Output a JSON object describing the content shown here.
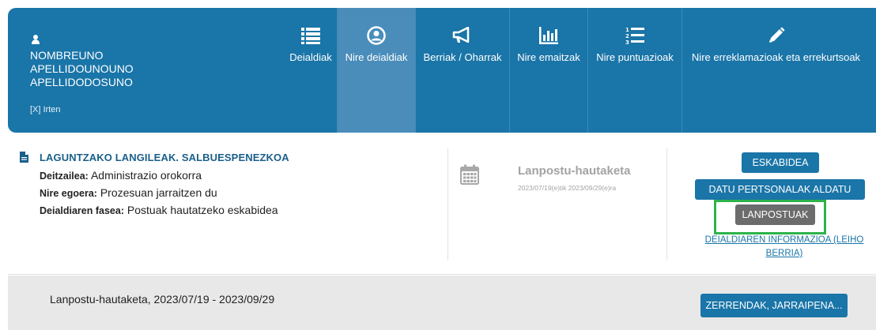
{
  "user": {
    "name_line1": "NOMBREUNO",
    "name_line2": "APELLIDOUNOUNO",
    "name_line3": "APELLIDODOSUNO",
    "logout": "[X] Irten",
    "icon": "user-icon"
  },
  "nav": [
    {
      "label": "Deialdiak",
      "icon": "list-icon",
      "active": false
    },
    {
      "label": "Nire deialdiak",
      "icon": "user-circle-icon",
      "active": true
    },
    {
      "label": "Berriak / Oharrak",
      "icon": "megaphone-icon",
      "active": false
    },
    {
      "label": "Nire emaitzak",
      "icon": "bar-chart-icon",
      "active": false
    },
    {
      "label": "Nire puntuazioak",
      "icon": "ordered-list-icon",
      "active": false
    },
    {
      "label": "Nire erreklamazioak eta errekurtsoak",
      "icon": "pencil-icon",
      "active": false
    }
  ],
  "call": {
    "title": "LAGUNTZAKO LANGILEAK. SALBUESPENEZKOA",
    "convener_label": "Deitzailea:",
    "convener_value": "Administrazio orokorra",
    "status_label": "Nire egoera:",
    "status_value": "Prozesuan jarraitzen du",
    "phase_label": "Deialdiaren fasea:",
    "phase_value": "Postuak hautatzeko eskabidea"
  },
  "phase": {
    "title": "Lanpostu-hautaketa",
    "dates": "2023/07/19(e)tik 2023/09/29(e)ra"
  },
  "buttons": {
    "application": "ESKABIDEA",
    "personal_data": "DATU PERTSONALAK ALDATU",
    "positions": "LANPOSTUAK",
    "info_link": "DEIALDIAREN INFORMAZIOA (LEIHO BERRIA)"
  },
  "panel": {
    "text": "Lanpostu-hautaketa, 2023/07/19 - 2023/09/29",
    "button": "ZERRENDAK, JARRAIPENA..."
  },
  "colors": {
    "primary": "#1a75a8",
    "active_tab": "#4a8dba",
    "highlight": "#2db34a",
    "gray_button": "#6c6c6c"
  }
}
